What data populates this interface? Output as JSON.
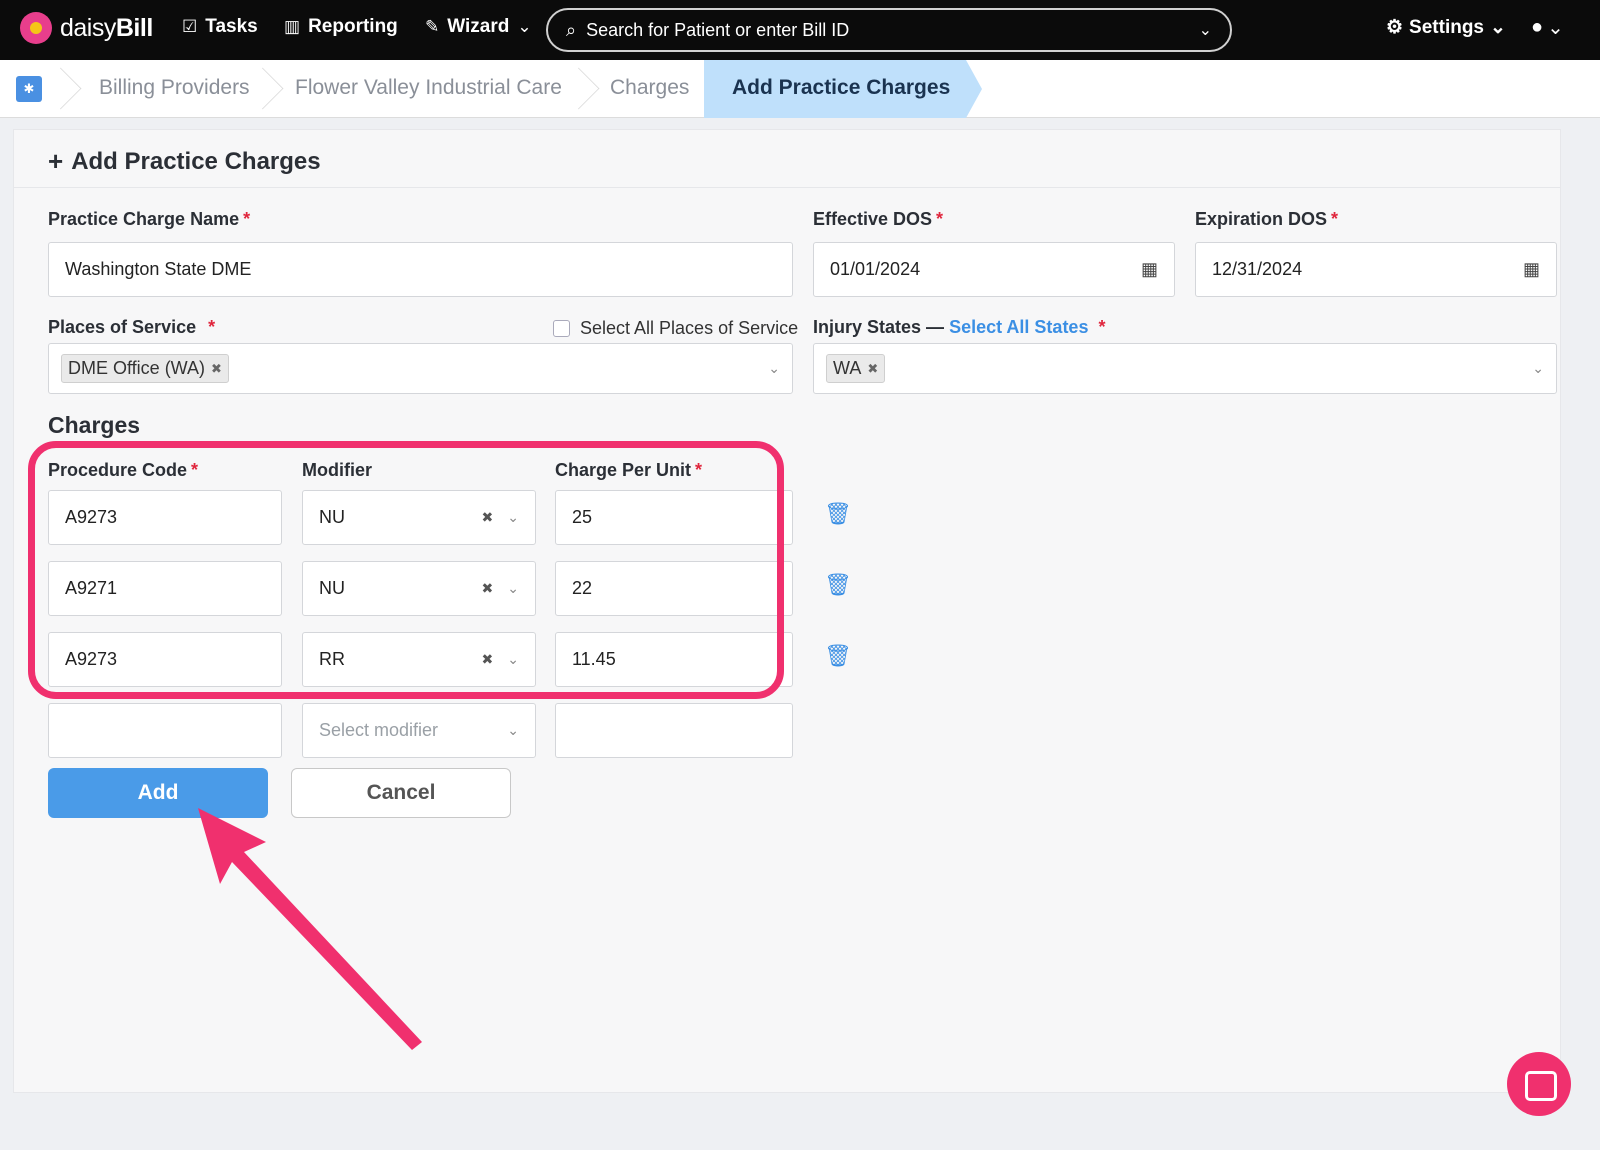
{
  "topbar": {
    "brand_light": "daisy",
    "brand_bold": "Bill",
    "tasks": "Tasks",
    "reporting": "Reporting",
    "wizard": "Wizard",
    "search_placeholder": "Search for Patient or enter Bill ID",
    "settings": "Settings"
  },
  "breadcrumb": {
    "items": [
      "Billing Providers",
      "Flower Valley Industrial Care",
      "Charges"
    ],
    "active": "Add Practice Charges"
  },
  "form": {
    "title": "Add Practice Charges",
    "practice_charge_name_label": "Practice Charge Name",
    "practice_charge_name_value": "Washington State DME",
    "effective_dos_label": "Effective DOS",
    "effective_dos_value": "01/01/2024",
    "expiration_dos_label": "Expiration DOS",
    "expiration_dos_value": "12/31/2024",
    "places_of_service_label": "Places of Service",
    "select_all_places_label": "Select All Places of Service",
    "place_tag": "DME Office (WA)",
    "injury_states_label": "Injury States —",
    "select_all_states": "Select All States",
    "state_tag": "WA",
    "required_mark": "*"
  },
  "charges": {
    "section_title": "Charges",
    "col_procedure": "Procedure Code",
    "col_modifier": "Modifier",
    "col_charge": "Charge Per Unit",
    "rows": [
      {
        "code": "A9273",
        "modifier": "NU",
        "charge": "25"
      },
      {
        "code": "A9271",
        "modifier": "NU",
        "charge": "22"
      },
      {
        "code": "A9273",
        "modifier": "RR",
        "charge": "11.45"
      }
    ],
    "modifier_placeholder": "Select modifier"
  },
  "buttons": {
    "add": "Add",
    "cancel": "Cancel"
  },
  "colors": {
    "accent": "#4a9be8",
    "highlight": "#f0306e",
    "breadcrumb_active": "#bfe0fb"
  }
}
